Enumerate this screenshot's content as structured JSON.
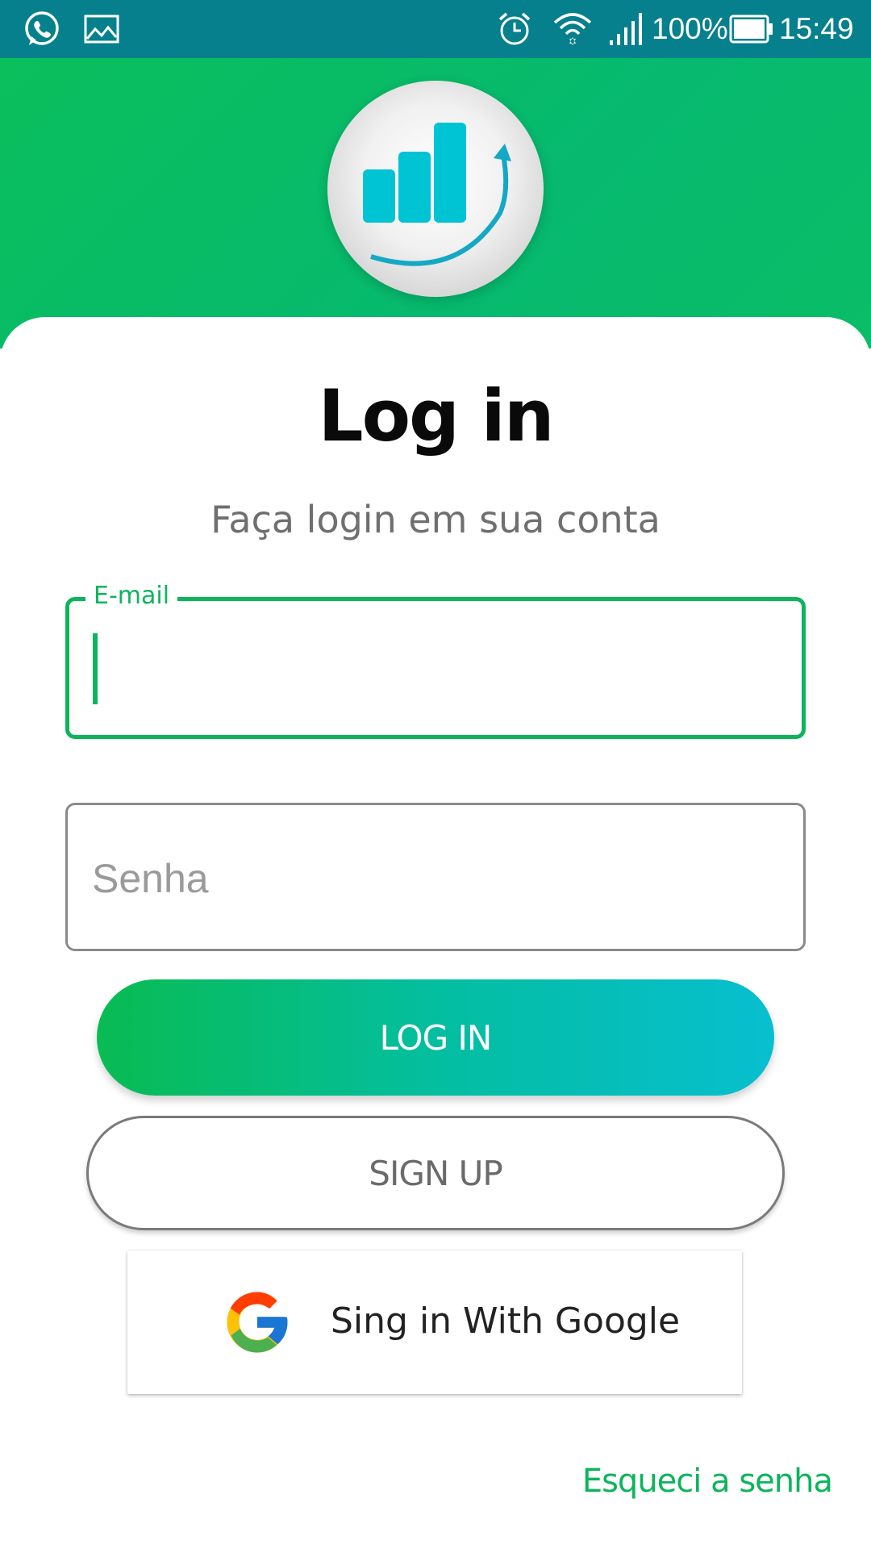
{
  "status_bar": {
    "battery": "100%",
    "time": "15:49",
    "icons": [
      "whatsapp-icon",
      "gallery-icon",
      "alarm-icon",
      "wifi-icon",
      "signal-icon",
      "battery-icon"
    ]
  },
  "header": {
    "logo_icon": "growth-chart-logo-icon",
    "colors": {
      "header_green": "#0abf5c",
      "status_teal": "#05808c",
      "logo_bars": "#00c3d4"
    }
  },
  "login": {
    "title": "Log in",
    "subtitle": "Faça login em sua conta",
    "email": {
      "label": "E-mail",
      "value": ""
    },
    "password": {
      "placeholder": "Senha",
      "value": ""
    },
    "login_button": "LOG IN",
    "signup_button": "SIGN UP",
    "google_button": "Sing in With Google",
    "forgot_password": "Esqueci a senha",
    "colors": {
      "accent_green": "#0db45c",
      "gradient_end": "#07bfcf"
    }
  }
}
